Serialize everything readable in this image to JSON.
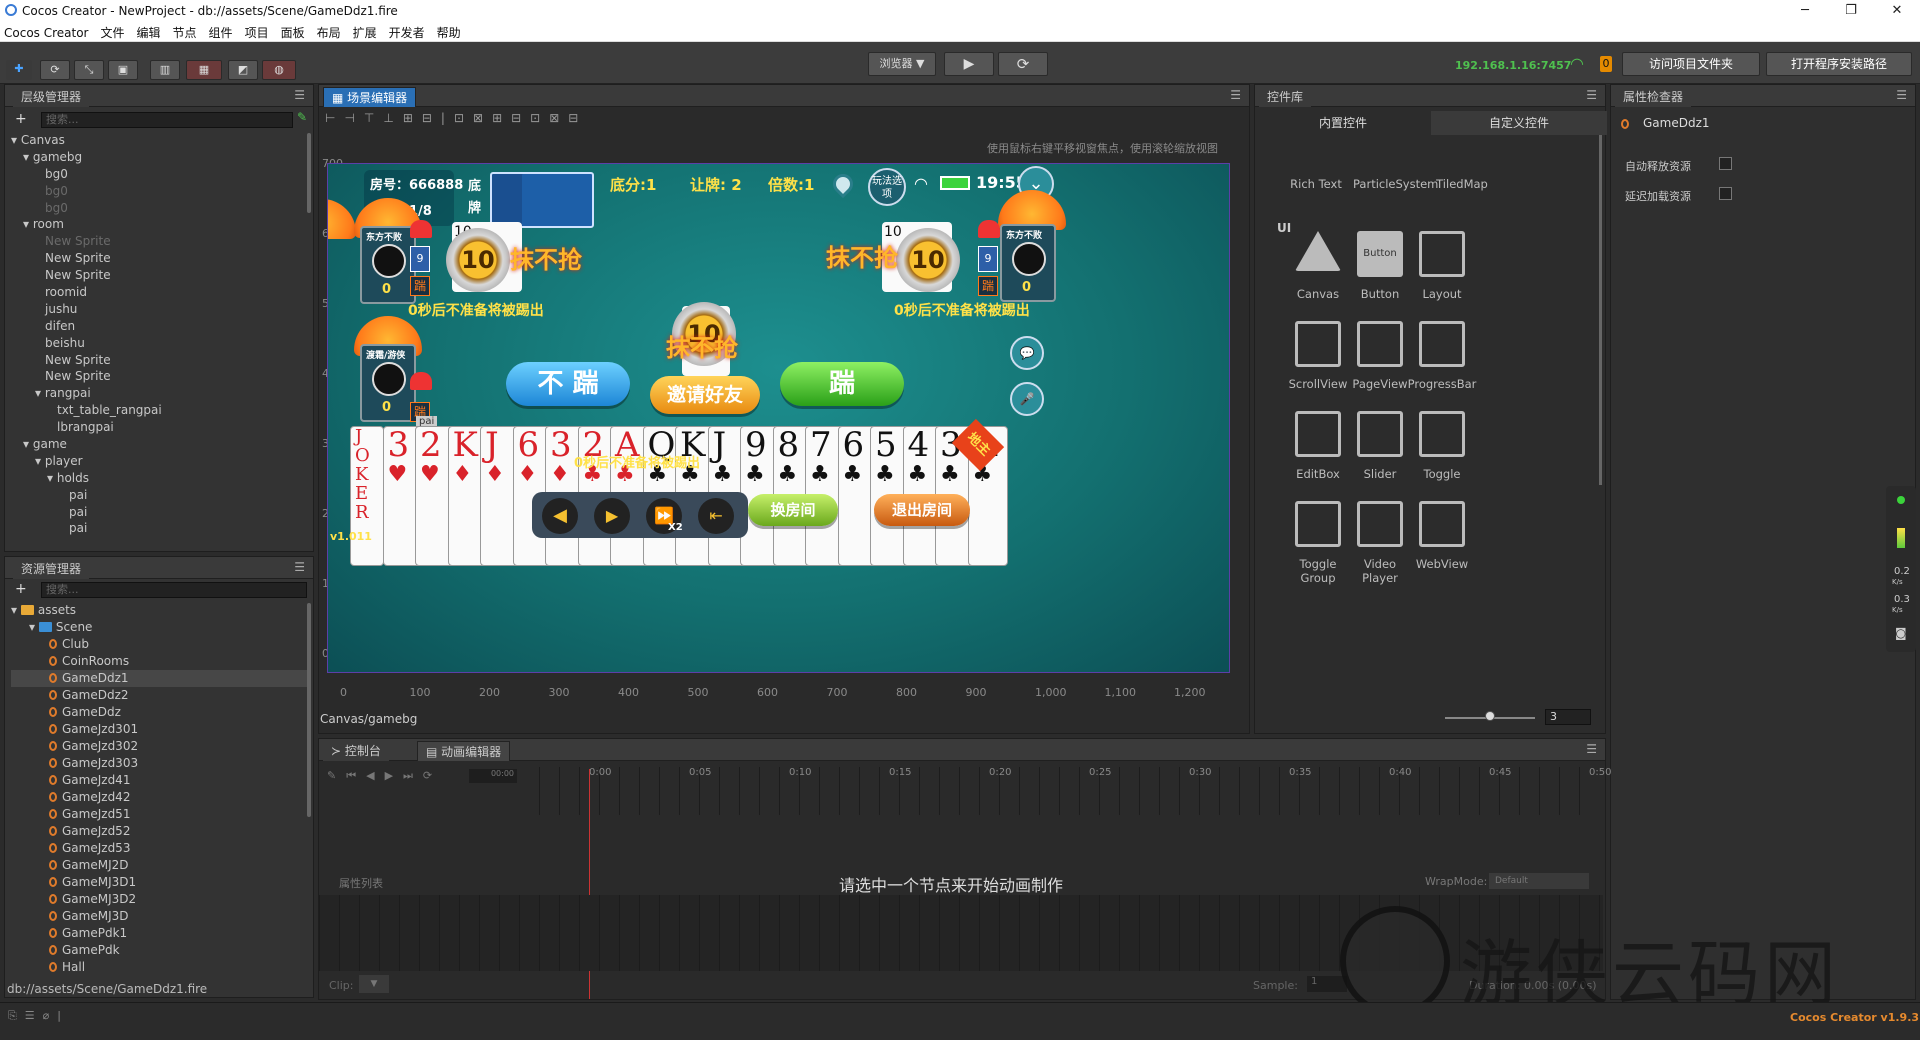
{
  "window": {
    "title": "Cocos Creator - NewProject - db://assets/Scene/GameDdz1.fire",
    "min": "─",
    "max": "❐",
    "close": "✕"
  },
  "menu": [
    "Cocos Creator",
    "文件",
    "编辑",
    "节点",
    "组件",
    "项目",
    "面板",
    "布局",
    "扩展",
    "开发者",
    "帮助"
  ],
  "toolbar": {
    "preview_select": "浏览器 ▼",
    "play": "▶",
    "refresh": "⟳",
    "ip": "192.168.1.16:7457",
    "badge": "0",
    "open_project_folder": "访问项目文件夹",
    "open_install_path": "打开程序安装路径"
  },
  "hierarchy": {
    "tab": "层级管理器",
    "search_placeholder": "搜索...",
    "items": [
      {
        "label": "Canvas",
        "level": 0,
        "arrow": true,
        "dim": false
      },
      {
        "label": "gamebg",
        "level": 1,
        "arrow": true,
        "dim": false
      },
      {
        "label": "bg0",
        "level": 2,
        "arrow": false,
        "dim": false
      },
      {
        "label": "bg0",
        "level": 2,
        "arrow": false,
        "dim": true
      },
      {
        "label": "bg0",
        "level": 2,
        "arrow": false,
        "dim": true
      },
      {
        "label": "room",
        "level": 1,
        "arrow": true,
        "dim": false
      },
      {
        "label": "New Sprite",
        "level": 2,
        "arrow": false,
        "dim": true
      },
      {
        "label": "New Sprite",
        "level": 2,
        "arrow": false,
        "dim": false
      },
      {
        "label": "New Sprite",
        "level": 2,
        "arrow": false,
        "dim": false
      },
      {
        "label": "roomid",
        "level": 2,
        "arrow": false,
        "dim": false
      },
      {
        "label": "jushu",
        "level": 2,
        "arrow": false,
        "dim": false
      },
      {
        "label": "difen",
        "level": 2,
        "arrow": false,
        "dim": false
      },
      {
        "label": "beishu",
        "level": 2,
        "arrow": false,
        "dim": false
      },
      {
        "label": "New Sprite",
        "level": 2,
        "arrow": false,
        "dim": false
      },
      {
        "label": "New Sprite",
        "level": 2,
        "arrow": false,
        "dim": false
      },
      {
        "label": "rangpai",
        "level": 2,
        "arrow": true,
        "dim": false
      },
      {
        "label": "txt_table_rangpai",
        "level": 3,
        "arrow": false,
        "dim": false
      },
      {
        "label": "lbrangpai",
        "level": 3,
        "arrow": false,
        "dim": false
      },
      {
        "label": "game",
        "level": 1,
        "arrow": true,
        "dim": false
      },
      {
        "label": "player",
        "level": 2,
        "arrow": true,
        "dim": false
      },
      {
        "label": "holds",
        "level": 3,
        "arrow": true,
        "dim": false
      },
      {
        "label": "pai",
        "level": 4,
        "arrow": false,
        "dim": false
      },
      {
        "label": "pai",
        "level": 4,
        "arrow": false,
        "dim": false
      },
      {
        "label": "pai",
        "level": 4,
        "arrow": false,
        "dim": false
      }
    ]
  },
  "assets": {
    "tab": "资源管理器",
    "search_placeholder": "搜索...",
    "root": "assets",
    "folder": "Scene",
    "files": [
      "Club",
      "CoinRooms",
      "GameDdz1",
      "GameDdz2",
      "GameDdz",
      "GameJzd301",
      "GameJzd302",
      "GameJzd303",
      "GameJzd41",
      "GameJzd42",
      "GameJzd51",
      "GameJzd52",
      "GameJzd53",
      "GameMJ2D",
      "GameMJ3D1",
      "GameMJ3D2",
      "GameMJ3D",
      "GamePdk1",
      "GamePdk",
      "Hall"
    ],
    "selected": "GameDdz1",
    "status_path": "db://assets/Scene/GameDdz1.fire"
  },
  "scene_editor": {
    "tab": "场景编辑器",
    "hint": "使用鼠标右键平移视窗焦点，使用滚轮缩放视图",
    "y_ticks": [
      "700",
      "600",
      "500",
      "400",
      "300",
      "200",
      "100",
      "0"
    ],
    "x_ticks": [
      "0",
      "100",
      "200",
      "300",
      "400",
      "500",
      "600",
      "700",
      "800",
      "900",
      "1,000",
      "1,100",
      "1,200"
    ],
    "breadcrumb": "Canvas/gamebg"
  },
  "game": {
    "room_no": "房号：666888",
    "round": "局数：1/8",
    "dipai_label": "底牌",
    "score": "底分:1",
    "rangpai": "让牌: 2",
    "beishu": "倍数:1",
    "rules_btn": "玩法选项",
    "time": "19:55",
    "left_player_name": "东方不败",
    "right_player_name": "东方不败",
    "bottom_player_name": "渡霜/游侠",
    "left_count": "9",
    "right_count": "9",
    "left_score": "0",
    "right_score": "0",
    "bottom_score": "0",
    "kick_tag": "踹",
    "timer_value": "10",
    "no_grab": "抹不抢",
    "kick_warning": "0秒后不准备将被踢出",
    "btn_no_kick": "不 踹",
    "btn_invite": "邀请好友",
    "btn_kick": "踹",
    "btn_change_room": "换房间",
    "btn_exit_room": "退出房间",
    "landlord": "地主",
    "version": "v1.011",
    "pai_label": "pai",
    "speed_label": "X2",
    "hand": [
      {
        "rank": "JOKER",
        "color": "red"
      },
      {
        "rank": "3",
        "suit": "♥",
        "color": "red"
      },
      {
        "rank": "2",
        "suit": "♥",
        "color": "red"
      },
      {
        "rank": "K",
        "suit": "♦",
        "color": "red"
      },
      {
        "rank": "J",
        "suit": "♦",
        "color": "red"
      },
      {
        "rank": "6",
        "suit": "♦",
        "color": "red"
      },
      {
        "rank": "3",
        "suit": "♦",
        "color": "red"
      },
      {
        "rank": "2",
        "suit": "♣",
        "color": "red"
      },
      {
        "rank": "A",
        "suit": "♣",
        "color": "red"
      },
      {
        "rank": "Q",
        "suit": "♣",
        "color": "blk"
      },
      {
        "rank": "K",
        "suit": "♣",
        "color": "blk"
      },
      {
        "rank": "J",
        "suit": "♣",
        "color": "blk"
      },
      {
        "rank": "9",
        "suit": "♣",
        "color": "blk"
      },
      {
        "rank": "8",
        "suit": "♣",
        "color": "blk"
      },
      {
        "rank": "7",
        "suit": "♣",
        "color": "blk"
      },
      {
        "rank": "6",
        "suit": "♣",
        "color": "blk"
      },
      {
        "rank": "5",
        "suit": "♣",
        "color": "blk"
      },
      {
        "rank": "4",
        "suit": "♣",
        "color": "blk"
      },
      {
        "rank": "3",
        "suit": "♣",
        "color": "blk"
      },
      {
        "rank": "A",
        "suit": "♣",
        "color": "blk"
      }
    ]
  },
  "library": {
    "tab": "控件库",
    "subtab_builtin": "内置控件",
    "subtab_custom": "自定义控件",
    "top_row": [
      "Rich Text",
      "ParticleSystem",
      "TiledMap"
    ],
    "section_ui": "UI",
    "items": [
      "Canvas",
      "Button",
      "Layout",
      "ScrollView",
      "PageView",
      "ProgressBar",
      "EditBox",
      "Slider",
      "Toggle",
      "Toggle Group",
      "Video Player",
      "WebView"
    ],
    "button_preview": "Button",
    "zoom_value": "3"
  },
  "inspector": {
    "tab": "属性检查器",
    "node": "GameDdz1",
    "auto_release": "自动释放资源",
    "lazy_load": "延迟加载资源"
  },
  "console": {
    "tab": "控制台"
  },
  "animation": {
    "tab": "动画编辑器",
    "time_field": "00:00",
    "ticks": [
      "0:00",
      "0:05",
      "0:10",
      "0:15",
      "0:20",
      "0:25",
      "0:30",
      "0:35",
      "0:40",
      "0:45",
      "0:50"
    ],
    "prop_list": "属性列表",
    "empty_msg": "请选中一个节点来开始动画制作",
    "wrapmode_label": "WrapMode:",
    "wrapmode_value": "Default",
    "clip_label": "Clip:",
    "sample_label": "Sample:",
    "sample_value": "1",
    "duration": "Duration: 0.00s (0.00s)"
  },
  "side": {
    "net_down": "0.2",
    "net_unit": "K/s",
    "net_up": "0.3"
  },
  "watermark": "游侠云码网",
  "footer": {
    "version": "Cocos Creator v1.9.3"
  }
}
